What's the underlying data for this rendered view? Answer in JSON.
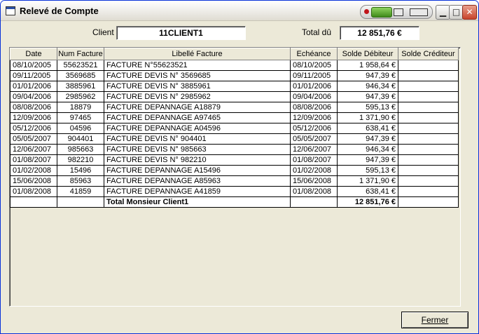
{
  "window": {
    "title": "Relevé de Compte"
  },
  "header": {
    "client_label": "Client",
    "client_value": "11CLIENT1",
    "total_label": "Total dû",
    "total_value": "12 851,76 €"
  },
  "table": {
    "columns": [
      "Date",
      "Num Facture",
      "Libellé Facture",
      "Echéance",
      "Solde Débiteur",
      "Solde Créditeur"
    ],
    "rows": [
      [
        "08/10/2005",
        "55623521",
        "FACTURE N°55623521",
        "08/10/2005",
        "1 958,64 €",
        ""
      ],
      [
        "09/11/2005",
        "3569685",
        "FACTURE DEVIS N° 3569685",
        "09/11/2005",
        "947,39 €",
        ""
      ],
      [
        "01/01/2006",
        "3885961",
        "FACTURE DEVIS N° 3885961",
        "01/01/2006",
        "946,34 €",
        ""
      ],
      [
        "09/04/2006",
        "2985962",
        "FACTURE DEVIS N° 2985962",
        "09/04/2006",
        "947,39 €",
        ""
      ],
      [
        "08/08/2006",
        "18879",
        "FACTURE DEPANNAGE A18879",
        "08/08/2006",
        "595,13 €",
        ""
      ],
      [
        "12/09/2006",
        "97465",
        "FACTURE DEPANNAGE A97465",
        "12/09/2006",
        "1 371,90 €",
        ""
      ],
      [
        "05/12/2006",
        "04596",
        "FACTURE DEPANNAGE A04596",
        "05/12/2006",
        "638,41 €",
        ""
      ],
      [
        "05/05/2007",
        "904401",
        "FACTURE DEVIS N° 904401",
        "05/05/2007",
        "947,39 €",
        ""
      ],
      [
        "12/06/2007",
        "985663",
        "FACTURE DEVIS N° 985663",
        "12/06/2007",
        "946,34 €",
        ""
      ],
      [
        "01/08/2007",
        "982210",
        "FACTURE DEVIS N° 982210",
        "01/08/2007",
        "947,39 €",
        ""
      ],
      [
        "01/02/2008",
        "15496",
        "FACTURE DEPANNAGE A15496",
        "01/02/2008",
        "595,13 €",
        ""
      ],
      [
        "15/06/2008",
        "85963",
        "FACTURE DEPANNAGE A85963",
        "15/06/2008",
        "1 371,90 €",
        ""
      ],
      [
        "01/08/2008",
        "41859",
        "FACTURE DEPANNAGE A41859",
        "01/08/2008",
        "638,41 €",
        ""
      ]
    ],
    "total_row": [
      "",
      "",
      "Total Monsieur Client1",
      "",
      "12 851,76 €",
      ""
    ]
  },
  "footer": {
    "close_button": "Fermer"
  },
  "icons": {
    "app": "window-icon",
    "minimize": "minimize-icon",
    "maximize": "maximize-icon",
    "close": "close-icon"
  },
  "colors": {
    "window_border": "#0831d9",
    "close_button": "#c8432b",
    "face": "#ece9d8"
  }
}
